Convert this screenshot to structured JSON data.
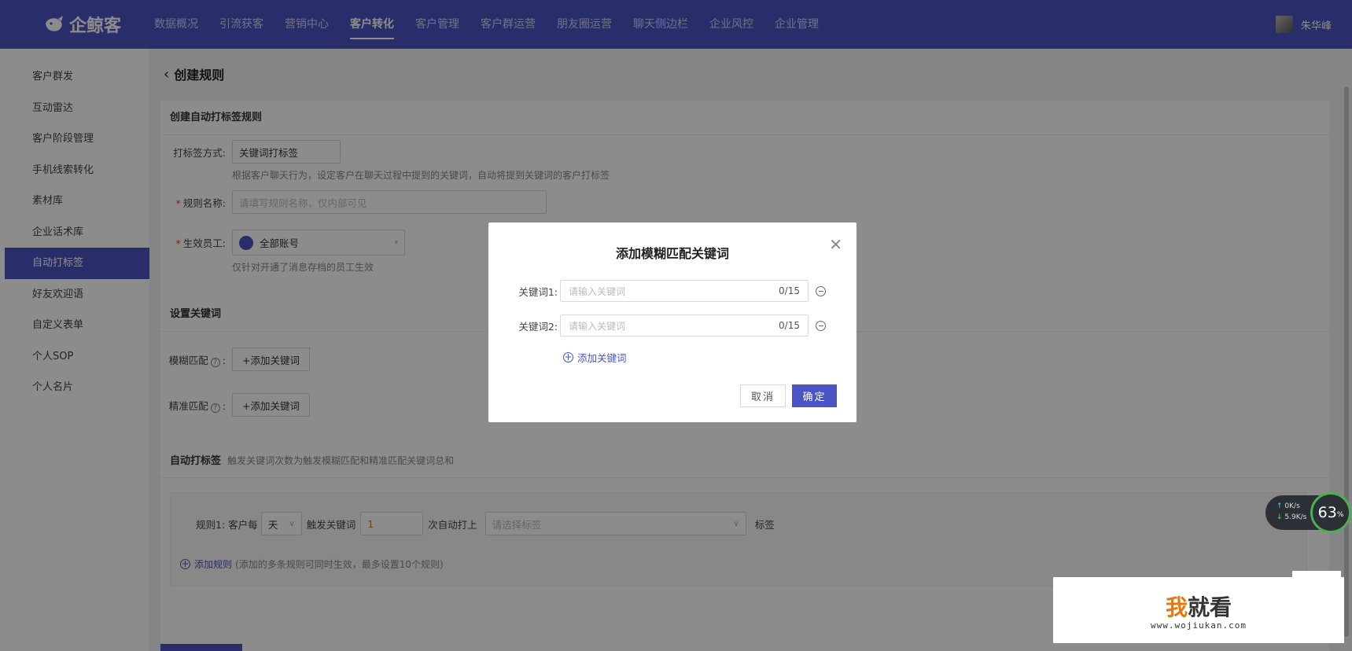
{
  "topbar": {
    "brand": "企鲸客",
    "nav": [
      "数据概况",
      "引流获客",
      "营销中心",
      "客户转化",
      "客户管理",
      "客户群运营",
      "朋友圈运营",
      "聊天侧边栏",
      "企业风控",
      "企业管理"
    ],
    "active_nav": "客户转化",
    "user_name": "朱华峰"
  },
  "sidebar": {
    "items": [
      "客户群发",
      "互动雷达",
      "客户阶段管理",
      "手机线索转化",
      "素材库",
      "企业话术库",
      "自动打标签",
      "好友欢迎语",
      "自定义表单",
      "个人SOP",
      "个人名片"
    ],
    "active": "自动打标签"
  },
  "page": {
    "title": "创建规则",
    "section1_title": "创建自动打标签规则",
    "tag_method_label": "打标签方式:",
    "tag_method_value": "关键词打标签",
    "tag_method_help": "根据客户聊天行为，设定客户在聊天过程中提到的关键词，自动将提到关键词的客户打标签",
    "rule_name_label": "规则名称:",
    "rule_name_placeholder": "请填写规则名称，仅内部可见",
    "staff_label": "生效员工:",
    "staff_value": "全部账号",
    "staff_help": "仅针对开通了消息存档的员工生效",
    "section2_title": "设置关键词",
    "fuzzy_label": "模糊匹配",
    "exact_label": "精准匹配",
    "add_keyword_btn": "+添加关键词",
    "section3_title": "自动打标签",
    "section3_hint": "触发关键词次数为触发模糊匹配和精准匹配关键词总和",
    "rule": {
      "prefix": "规则1:",
      "per_label": "客户每",
      "period": "天",
      "trigger_label": "触发关键词",
      "count": "1",
      "auto_label": "次自动打上",
      "tag_placeholder": "请选择标签",
      "suffix": "标签"
    },
    "add_rule": "添加规则",
    "add_rule_hint": "(添加的多条规则可同时生效，最多设置10个规则)"
  },
  "modal": {
    "title": "添加模糊匹配关键词",
    "keywords": [
      {
        "label": "关键词1:",
        "placeholder": "请输入关键词",
        "count": "0/15"
      },
      {
        "label": "关键词2:",
        "placeholder": "请输入关键词",
        "count": "0/15"
      }
    ],
    "add_keyword": "添加关键词",
    "cancel": "取消",
    "confirm": "确定"
  },
  "speed_widget": {
    "up": "0K/s",
    "down": "5.9K/s",
    "percent": "63",
    "percent_unit": "%"
  },
  "watermark": {
    "text_highlight": "我",
    "text_rest": "就看",
    "url": "www.wojiukan.com"
  },
  "colors": {
    "brand": "#4b54c4",
    "required": "#e4393c"
  }
}
